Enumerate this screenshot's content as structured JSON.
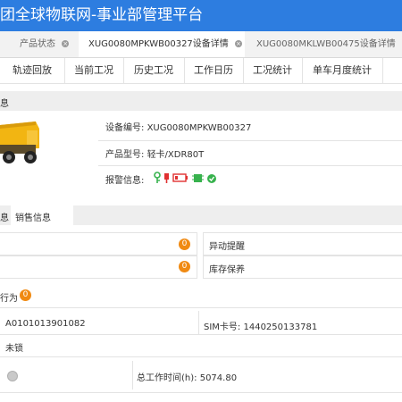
{
  "header": {
    "title": "团全球物联网-事业部管理平台"
  },
  "tabs": [
    {
      "label": "产品状态"
    },
    {
      "label": "XUG0080MPKWB00327设备详情"
    },
    {
      "label": "XUG0080MKLWB00475设备详情"
    }
  ],
  "subnav": [
    {
      "label": "轨迹回放"
    },
    {
      "label": "当前工况"
    },
    {
      "label": "历史工况"
    },
    {
      "label": "工作日历"
    },
    {
      "label": "工况统计"
    },
    {
      "label": "单车月度统计"
    }
  ],
  "device": {
    "section_title": "息",
    "serial_label": "设备编号:",
    "serial_value": "XUG0080MPKWB00327",
    "model_label": "产品型号:",
    "model_value": "轻卡/XDR80T",
    "alarm_label": "报警信息:"
  },
  "alarm_icons": [
    "key-icon",
    "battery-icon",
    "chip-icon"
  ],
  "sales_section": {
    "left_tab": "息",
    "right_tab": "销售信息"
  },
  "stats": {
    "row1_badge": "0",
    "row1_right_label": "异动提醒",
    "row2_badge": "0",
    "row2_right_label": "库存保养"
  },
  "behavior": {
    "label": "行为",
    "badge": "0"
  },
  "info": {
    "code": "A0101013901082",
    "sim_label": "SIM卡号:",
    "sim_value": "1440250133781",
    "lock_status": "未锁",
    "work_time_label": "总工作时间(h):",
    "work_time_value": "5074.80"
  },
  "colors": {
    "header": "#2d7de0",
    "badge": "#f08a12",
    "alarm_green": "#37b24d",
    "alarm_red": "#e03131"
  }
}
